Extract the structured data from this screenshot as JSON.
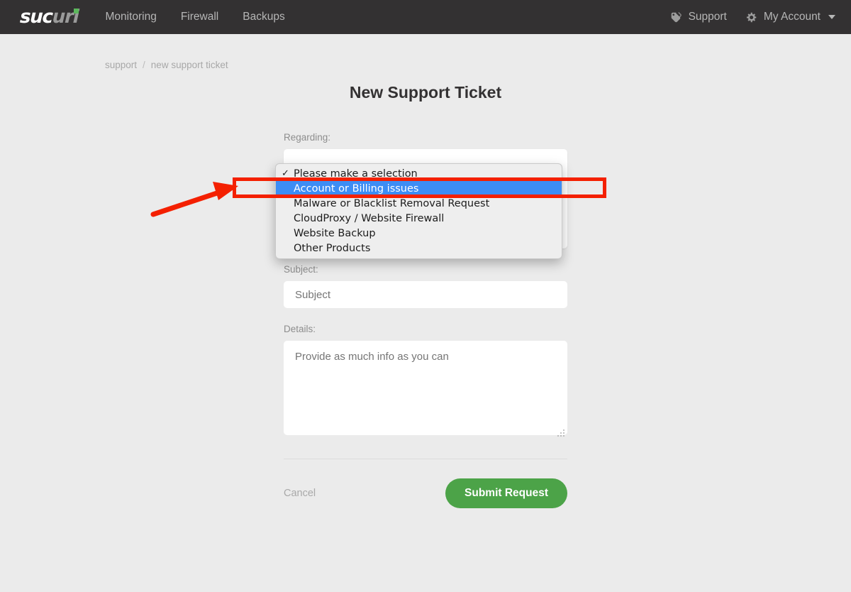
{
  "navbar": {
    "logo": {
      "part1": "suc",
      "part2": "uri",
      "accent_color": "#5cb85c"
    },
    "links": [
      {
        "label": "Monitoring"
      },
      {
        "label": "Firewall"
      },
      {
        "label": "Backups"
      }
    ],
    "right": [
      {
        "label": "Support",
        "icon": "tag-icon"
      },
      {
        "label": "My Account",
        "icon": "gear-icon",
        "has_caret": true
      }
    ],
    "background_color": "#333132"
  },
  "breadcrumb": {
    "parent": "support",
    "separator": "/",
    "current": "new support ticket"
  },
  "page": {
    "title": "New Support Ticket",
    "background_color": "#ebebeb"
  },
  "form": {
    "regarding": {
      "label": "Regarding:",
      "selected_value": "Please make a selection",
      "options": [
        {
          "label": "Please make a selection",
          "checked": true,
          "highlighted": false
        },
        {
          "label": "Account or Billing issues",
          "checked": false,
          "highlighted": true
        },
        {
          "label": "Malware or Blacklist Removal Request",
          "checked": false,
          "highlighted": false
        },
        {
          "label": "CloudProxy / Website Firewall",
          "checked": false,
          "highlighted": false
        },
        {
          "label": "Website Backup",
          "checked": false,
          "highlighted": false
        },
        {
          "label": "Other Products",
          "checked": false,
          "highlighted": false
        }
      ],
      "checkmark_glyph": "✓",
      "highlight_color": "#3d8df5"
    },
    "subject": {
      "label": "Subject:",
      "placeholder": "Subject",
      "value": ""
    },
    "details": {
      "label": "Details:",
      "placeholder": "Provide as much info as you can",
      "value": ""
    },
    "cancel_label": "Cancel",
    "submit_label": "Submit Request",
    "submit_color": "#4ca348"
  },
  "annotations": {
    "color": "#f42000",
    "highlight_box_target": "Account or Billing issues",
    "arrow_points_to": "Account or Billing issues"
  }
}
